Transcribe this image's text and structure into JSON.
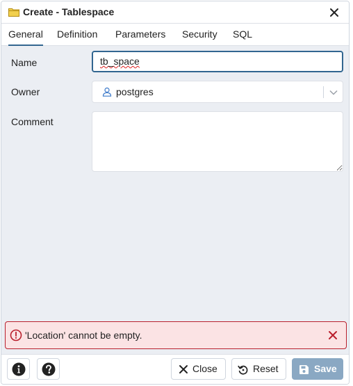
{
  "dialog": {
    "title": "Create - Tablespace"
  },
  "tabs": [
    {
      "label": "General",
      "active": true
    },
    {
      "label": "Definition",
      "active": false
    },
    {
      "label": "Parameters",
      "active": false
    },
    {
      "label": "Security",
      "active": false
    },
    {
      "label": "SQL",
      "active": false
    }
  ],
  "form": {
    "name_label": "Name",
    "name_value": "tb_space",
    "owner_label": "Owner",
    "owner_value": "postgres",
    "comment_label": "Comment",
    "comment_value": ""
  },
  "error": {
    "message": "'Location' cannot be empty."
  },
  "footer": {
    "close_label": "Close",
    "reset_label": "Reset",
    "save_label": "Save"
  },
  "colors": {
    "accent": "#326690",
    "error_border": "#b91f2c",
    "error_bg": "#fbe3e4",
    "content_bg": "#ebeef3",
    "save_disabled": "#8aa8c3"
  }
}
